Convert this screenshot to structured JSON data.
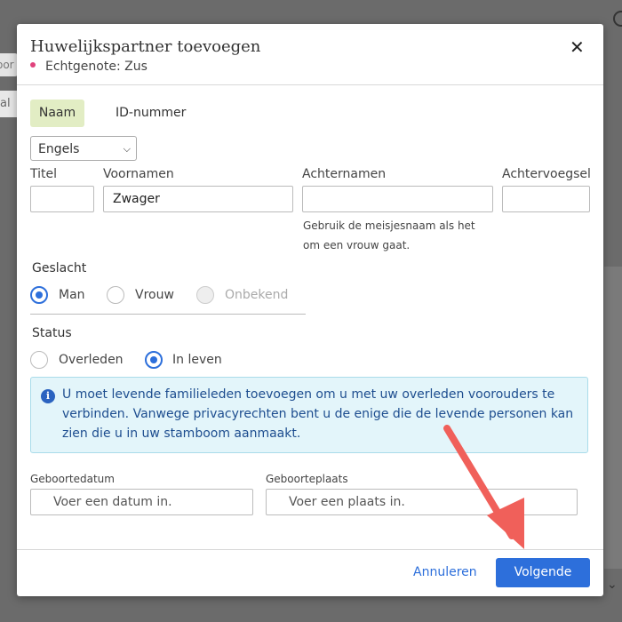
{
  "background": {
    "tab1_text": "oor",
    "tab2_text": "al"
  },
  "modal": {
    "title": "Huwelijkspartner toevoegen",
    "subtitle": "Echtgenote: Zus",
    "close_label": "✕",
    "tabs": [
      {
        "label": "Naam",
        "active": true
      },
      {
        "label": "ID-nummer",
        "active": false
      }
    ],
    "language_select": {
      "value": "Engels"
    },
    "fields": {
      "titel": {
        "label": "Titel",
        "value": ""
      },
      "voornamen": {
        "label": "Voornamen",
        "value": "Zwager"
      },
      "achternamen": {
        "label": "Achternamen",
        "value": "",
        "hint": "Gebruik de meisjesnaam als het om een vrouw gaat."
      },
      "achtervoegsel": {
        "label": "Achtervoegsel",
        "value": ""
      }
    },
    "gender": {
      "label": "Geslacht",
      "options": [
        {
          "label": "Man",
          "selected": true,
          "disabled": false
        },
        {
          "label": "Vrouw",
          "selected": false,
          "disabled": false
        },
        {
          "label": "Onbekend",
          "selected": false,
          "disabled": true
        }
      ]
    },
    "status": {
      "label": "Status",
      "options": [
        {
          "label": "Overleden",
          "selected": false
        },
        {
          "label": "In leven",
          "selected": true
        }
      ]
    },
    "info_icon": "i",
    "info_text": "U moet levende familieleden toevoegen om u met uw overleden voorouders te verbinden. Vanwege privacyrechten bent u de enige die de levende personen kan zien die u in uw stamboom aanmaakt.",
    "birth_date": {
      "label": "Geboortedatum",
      "placeholder": "Voer een datum in."
    },
    "birth_place": {
      "label": "Geboorteplaats",
      "placeholder": "Voer een plaats in."
    },
    "cancel_label": "Annuleren",
    "next_label": "Volgende"
  },
  "colors": {
    "accent": "#2d6fdb",
    "tab_active_bg": "#e2edc4",
    "info_bg": "#e3f5fa",
    "annotation_arrow": "#f0605a",
    "pink_dot": "#e0427c"
  }
}
